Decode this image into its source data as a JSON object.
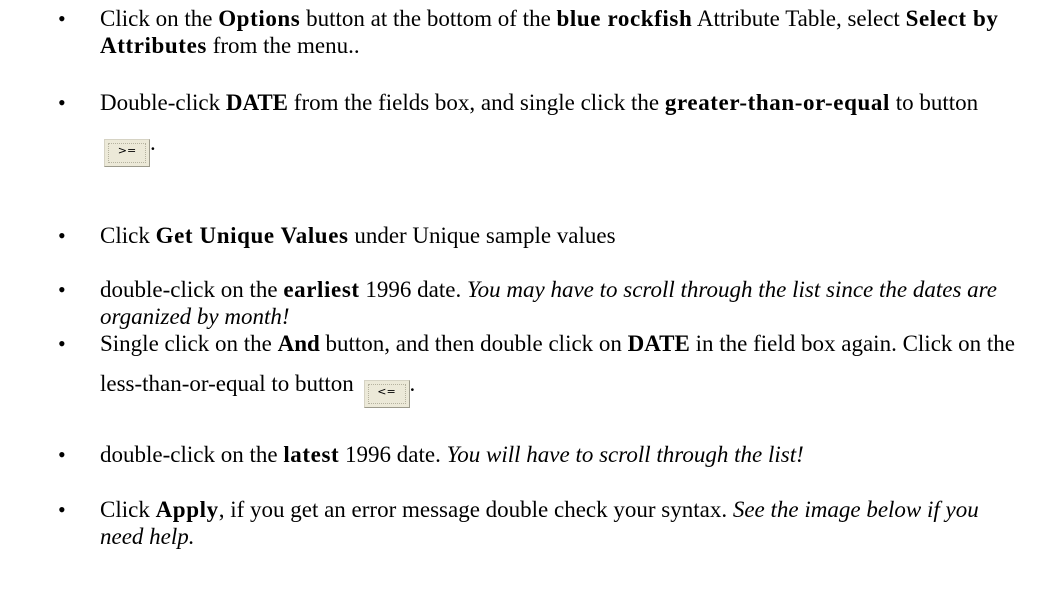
{
  "bullet": "•",
  "items": [
    {
      "t1": "Click on the ",
      "b1": "Options",
      "t2": " button at the bottom of the ",
      "b2": "blue rockfish",
      "t3": " Attribute Table, select ",
      "b3": "Select by Attributes",
      "t4": " from the menu.."
    },
    {
      "t1": "Double-click ",
      "b1": "DATE",
      "t2": " from the fields box, and single click the ",
      "b2": "greater-than-or-equal",
      "t3": " to button ",
      "btn": ">=",
      "t4": "."
    },
    {
      "t1": "Click ",
      "b1": "Get Unique Values",
      "t2": " under Unique sample values"
    },
    {
      "t1": "double-click on the ",
      "b1": "earliest",
      "t2": " 1996 date.  ",
      "i1": "You may have to scroll through the list since the dates are organized by month!"
    },
    {
      "t1": "Single click on the ",
      "b1": "And",
      "t2": " button, and then double click on ",
      "b2": "DATE",
      "t3": " in the field box again.  Click on the less-than-or-equal to button ",
      "btn": "<=",
      "t4": "."
    },
    {
      "t1": "double-click on the ",
      "b1": "latest",
      "t2": " 1996 date.  ",
      "i1": "You will have to scroll through the list!"
    },
    {
      "t1": "Click ",
      "b1": "Apply",
      "t2": ", if you get an error message double check your syntax.  ",
      "i1": "See the image below if you need help."
    }
  ]
}
